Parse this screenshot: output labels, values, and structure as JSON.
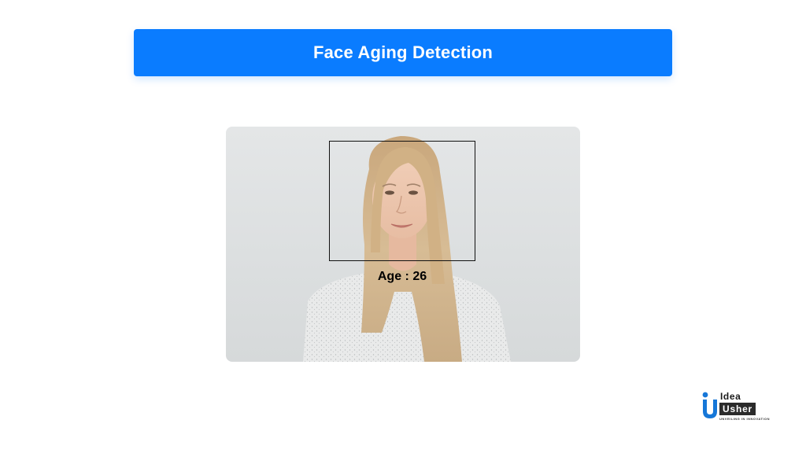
{
  "header": {
    "title": "Face Aging Detection"
  },
  "detection": {
    "age_label": "Age : 26"
  },
  "logo": {
    "line1": "Idea",
    "line2": "Usher",
    "tagline": "UNVEILING IN INNOVATION"
  },
  "colors": {
    "banner": "#0a7cff",
    "logo_accent": "#1677d8",
    "box_stroke": "#111111"
  }
}
